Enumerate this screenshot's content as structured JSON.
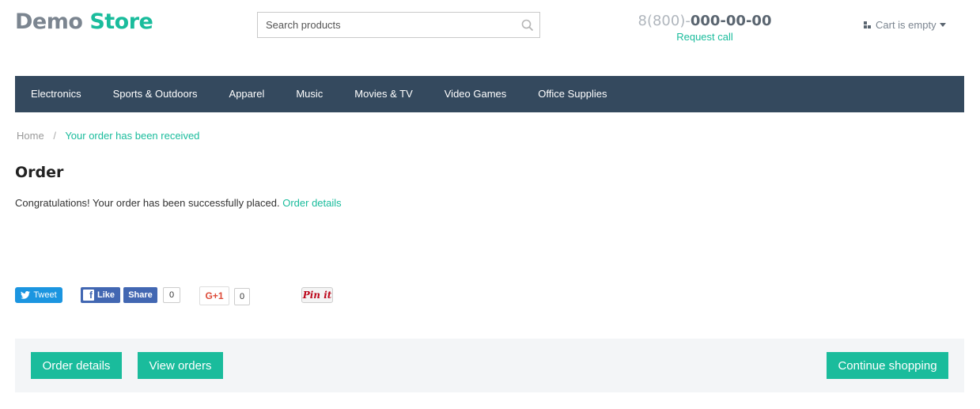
{
  "header": {
    "logo_part1": "Demo",
    "logo_part2": "Store",
    "search_placeholder": "Search products",
    "search_icon": "search-icon",
    "phone_prefix": "8(800)-",
    "phone_main": "000-00-00",
    "request_call": "Request call",
    "cart_label": "Cart is empty"
  },
  "nav": {
    "items": [
      {
        "label": "Electronics"
      },
      {
        "label": "Sports & Outdoors"
      },
      {
        "label": "Apparel"
      },
      {
        "label": "Music"
      },
      {
        "label": "Movies & TV"
      },
      {
        "label": "Video Games"
      },
      {
        "label": "Office Supplies"
      }
    ]
  },
  "breadcrumb": {
    "home": "Home",
    "separator": "/",
    "current": "Your order has been received"
  },
  "main": {
    "title": "Order",
    "message": "Congratulations! Your order has been successfully placed.",
    "message_link": "Order details"
  },
  "social": {
    "tweet": "Tweet",
    "fb_like": "Like",
    "fb_share": "Share",
    "fb_count": "0",
    "gplus": "G+1",
    "gplus_count": "0",
    "pinterest": "Pin it"
  },
  "actions": {
    "order_details": "Order details",
    "view_orders": "View orders",
    "continue_shopping": "Continue shopping"
  },
  "colors": {
    "accent": "#1abc9c",
    "nav_bg": "#34495e"
  }
}
